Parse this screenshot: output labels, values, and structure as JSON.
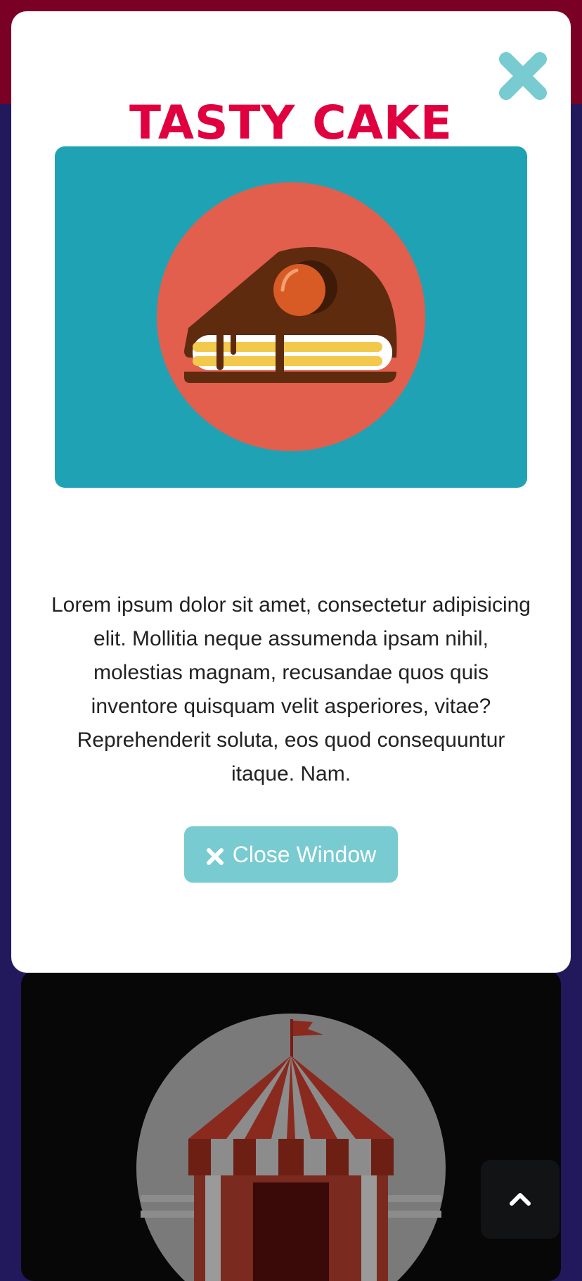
{
  "modal": {
    "title": "TASTY CAKE",
    "image_icon": "cake-slice-icon",
    "description": "Lorem ipsum dolor sit amet, consectetur adipisicing elit. Mollitia neque assumenda ipsam nihil, molestias magnam, recusandae quos quis inventore quisquam velit asperiores, vitae? Reprehenderit soluta, eos quod consequuntur itaque. Nam.",
    "close_button_label": "Close Window",
    "close_button_icon": "times-icon",
    "close_icon": "close-x-icon"
  },
  "background_card": {
    "image_icon": "circus-tent-icon"
  },
  "scroll_top_icon": "chevron-up-icon",
  "colors": {
    "top_band": "#7a0026",
    "page_background": "#21195c",
    "title": "#e1003f",
    "accent": "#77cbd1",
    "image_panel": "#20a2b5",
    "cake_circle": "#e15f4c"
  }
}
